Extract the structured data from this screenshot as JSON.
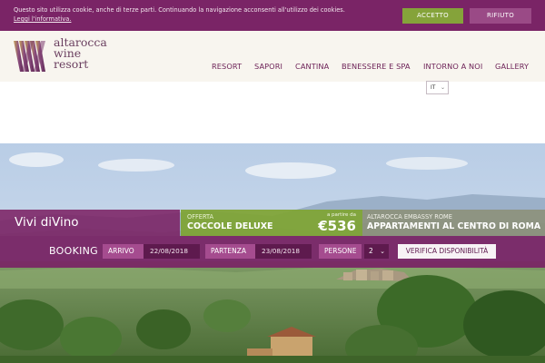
{
  "cookie": {
    "text": "Questo sito utilizza cookie, anche di terze parti. Continuando la navigazione acconsenti all'utilizzo dei cookies.",
    "link": "Leggi l'informativa.",
    "accept": "ACCETTO",
    "refuse": "RIFIUTO"
  },
  "brand": {
    "line1": "altarocca",
    "line2": "wine",
    "line3": "resort"
  },
  "nav": {
    "items": [
      "RESORT",
      "SAPORI",
      "CANTINA",
      "BENESSERE E SPA",
      "INTORNO A NOI",
      "GALLERY"
    ]
  },
  "lang": {
    "value": "IT"
  },
  "hero": {
    "title": "Vivi diVino"
  },
  "offer": {
    "label": "OFFERTA",
    "name": "COCCOLE DELUXE",
    "from": "a partire da",
    "price": "€536"
  },
  "embassy": {
    "label": "ALTAROCCA EMBASSY ROME",
    "name": "APPARTAMENTI AL CENTRO DI ROMA"
  },
  "booking": {
    "title": "BOOKING",
    "arrival_label": "ARRIVO",
    "arrival_value": "22/08/2018",
    "departure_label": "PARTENZA",
    "departure_value": "23/08/2018",
    "guests_label": "PERSONE",
    "guests_value": "2",
    "check_button": "VERIFICA DISPONIBILITÀ"
  },
  "colors": {
    "brand_purple": "#7a2466",
    "accept_green": "#85a33a",
    "offer_green": "#7fa434",
    "header_bg": "#f8f5ef"
  }
}
